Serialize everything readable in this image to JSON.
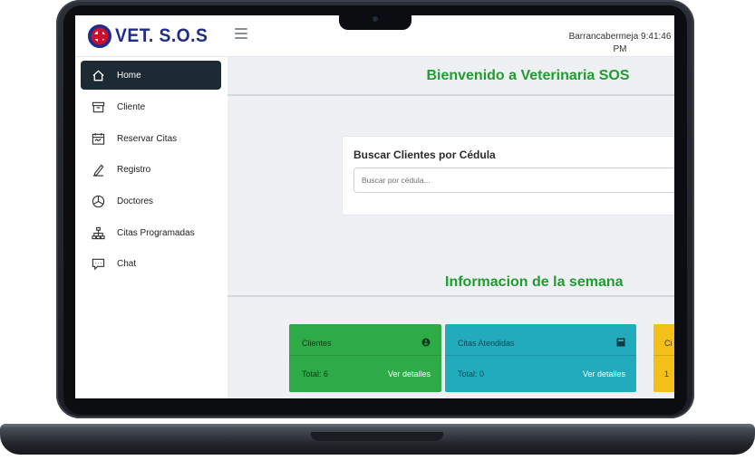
{
  "header": {
    "logo_text": "VET. S.O.S",
    "clock": "Barrancabermeja 9:41:46 PM"
  },
  "sidebar": {
    "items": [
      {
        "label": "Home",
        "icon": "home-icon",
        "active": true
      },
      {
        "label": "Cliente",
        "icon": "archive-icon",
        "active": false
      },
      {
        "label": "Reservar Citas",
        "icon": "calendar-icon",
        "active": false
      },
      {
        "label": "Registro",
        "icon": "pen-icon",
        "active": false
      },
      {
        "label": "Doctores",
        "icon": "chart-pie-icon",
        "active": false
      },
      {
        "label": "Citas Programadas",
        "icon": "sitemap-icon",
        "active": false
      },
      {
        "label": "Chat",
        "icon": "chat-icon",
        "active": false
      }
    ]
  },
  "main": {
    "welcome_title": "Bienvenido a Veterinaria SOS",
    "search": {
      "title": "Buscar Clientes por Cédula",
      "placeholder": "Buscar por cédula..."
    },
    "week_title": "Informacion de la semana",
    "stats": [
      {
        "title": "Clientes",
        "total": "Total: 6",
        "link": "Ver detalles",
        "color": "#2eaa46",
        "icon": "anchor-icon"
      },
      {
        "title": "Citas Atendidas",
        "total": "Total: 0",
        "link": "Ver detalles",
        "color": "#22aabd",
        "icon": "square-icon"
      },
      {
        "title": "Ci",
        "total": "1",
        "color": "#f3c019"
      }
    ]
  },
  "colors": {
    "accent_green": "#1f9d2e",
    "sidebar_active": "#1c2a33",
    "logo_blue": "#1f2d8a"
  }
}
